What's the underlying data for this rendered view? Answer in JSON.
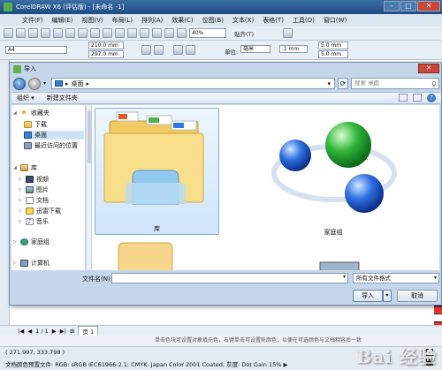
{
  "app": {
    "title": "CorelDRAW X6 (评估版) - [未命名 -1]"
  },
  "menu": [
    "文件(F)",
    "编辑(E)",
    "视图(V)",
    "布局(L)",
    "排列(A)",
    "效果(C)",
    "位图(B)",
    "文本(X)",
    "表格(T)",
    "工具(O)",
    "窗口(W)"
  ],
  "toolbar": {
    "zoom": "40%",
    "snap": "贴齐(T)"
  },
  "property_bar": {
    "page_size": "A4",
    "width": "210.0 mm",
    "height": "297.0 mm",
    "units_label": "单位:",
    "units_value": "毫米",
    "nudge": ".1 mm",
    "dup_x": "5.0 mm",
    "dup_y": "5.0 mm"
  },
  "dialog": {
    "title": "导入",
    "close": "✕",
    "address": "桌面",
    "search_placeholder": "搜索 桌面",
    "organize": "组织 ▾",
    "new_folder": "新建文件夹",
    "nav": {
      "favorites": "收藏夹",
      "downloads": "下载",
      "desktop": "桌面",
      "recent": "最近访问的位置",
      "libraries": "库",
      "videos": "视频",
      "pictures": "图片",
      "documents": "文档",
      "xunlei": "迅雷下载",
      "music": "音乐",
      "homegroup": "家庭组",
      "computer": "计算机"
    },
    "items": {
      "library": "库",
      "homegroup": "家庭组"
    },
    "filename_label": "文件名(N):",
    "filename_value": "",
    "filetype": "所有文件格式",
    "import_btn": "导入",
    "cancel_btn": "取消"
  },
  "pagebar": {
    "pages": "1 / 1",
    "tab": "页 1"
  },
  "hint": "单击色块可设置对象填充色，右键单击可设置轮廓色，以便在可选颜色与文档相容后一致",
  "status": {
    "coords": "( 271.997, 333.798 )",
    "profile": "文档颜色预置文件: RGB: sRGB IEC61966-2.1; CMYK: Japan Color 2001 Coated; 灰度: Dot Gain 15%  ▶"
  },
  "watermark": "Bai 经验"
}
